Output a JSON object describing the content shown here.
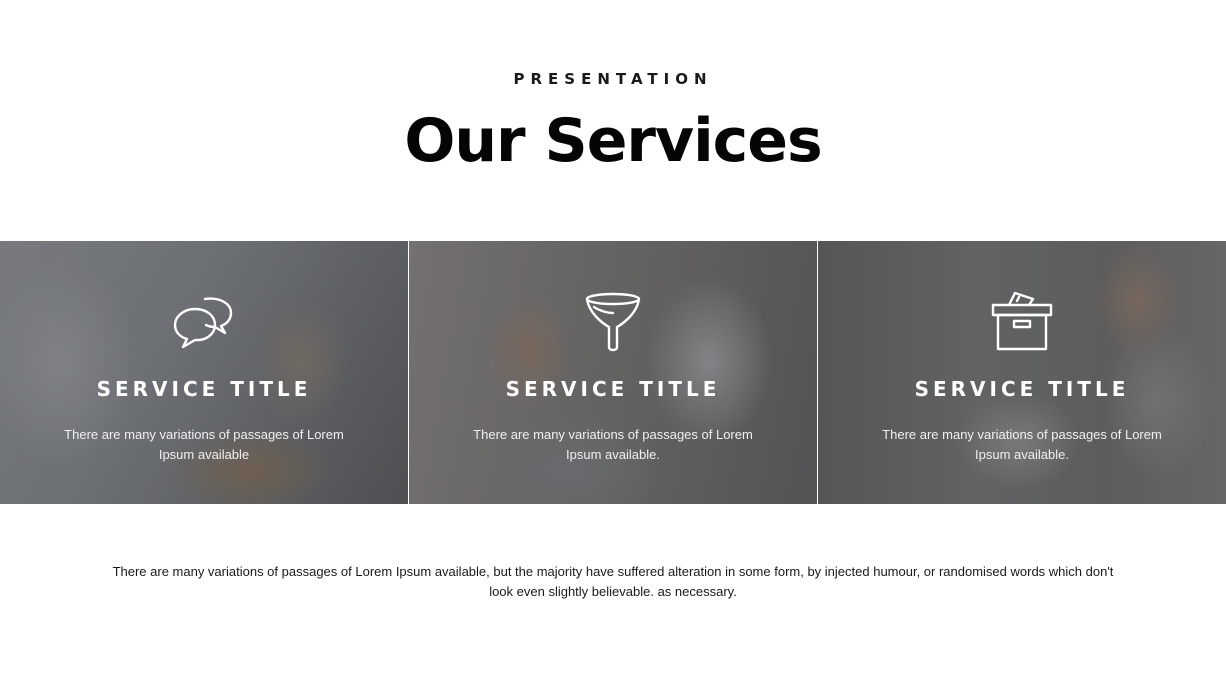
{
  "header": {
    "eyebrow": "PRESENTATION",
    "title": "Our Services"
  },
  "services": [
    {
      "icon": "speech-bubbles-icon",
      "title": "SERVICE TITLE",
      "text": "There are many variations of passages of Lorem Ipsum available"
    },
    {
      "icon": "funnel-icon",
      "title": "SERVICE TITLE",
      "text": "There are many variations of passages of Lorem Ipsum available."
    },
    {
      "icon": "archive-box-icon",
      "title": "SERVICE TITLE",
      "text": "There are many variations of passages of Lorem Ipsum available."
    }
  ],
  "footer": {
    "text": "There are many variations of passages of Lorem Ipsum available, but the majority have suffered alteration in some form, by injected humour, or randomised words which don't look even slightly believable.  as necessary."
  },
  "colors": {
    "title": "#050505",
    "overlay": "#28282c",
    "card_text": "#ffffff"
  }
}
